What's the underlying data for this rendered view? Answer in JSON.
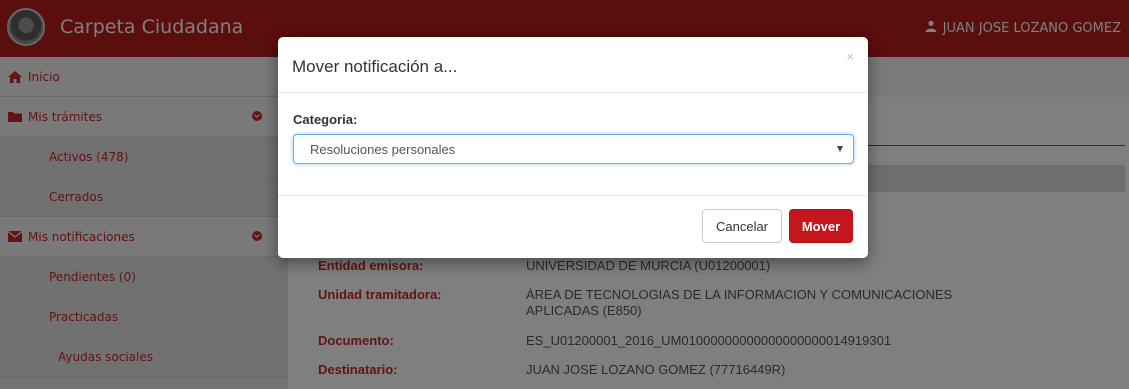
{
  "header": {
    "brand": "Carpeta Ciudadana",
    "user_name": "JUAN JOSE LOZANO GOMEZ"
  },
  "sidebar": {
    "items": [
      {
        "label": "Inicio",
        "icon": "home-icon"
      },
      {
        "label": "Mis trámites",
        "icon": "folder-icon"
      },
      {
        "label": "Activos (478)"
      },
      {
        "label": "Cerrados"
      },
      {
        "label": "Mis notificaciones",
        "icon": "envelope-icon"
      },
      {
        "label": "Pendientes (0)"
      },
      {
        "label": "Practicadas"
      },
      {
        "label": "Ayudas sociales"
      }
    ]
  },
  "details": {
    "rows": [
      {
        "label": "Entidad emisora:",
        "value": "UNIVERSIDAD DE MURCIA (U01200001)"
      },
      {
        "label": "Unidad tramitadora:",
        "value": "ÁREA DE TECNOLOGIAS DE LA INFORMACION Y COMUNICACIONES APLICADAS (E850)"
      },
      {
        "label": "Documento:",
        "value": "ES_U01200001_2016_UM01000000000000000000014919301"
      },
      {
        "label": "Destinatario:",
        "value": "JUAN JOSE LOZANO GOMEZ (77716449R)"
      }
    ]
  },
  "modal": {
    "title": "Mover notificación a...",
    "close_glyph": "×",
    "category_label": "Categoria:",
    "category_value": "Resoluciones personales",
    "cancel_label": "Cancelar",
    "move_label": "Mover"
  },
  "colors": {
    "brand_red": "#b71c1c",
    "accent_red": "#c4161c",
    "focus_blue": "#66afe9"
  }
}
